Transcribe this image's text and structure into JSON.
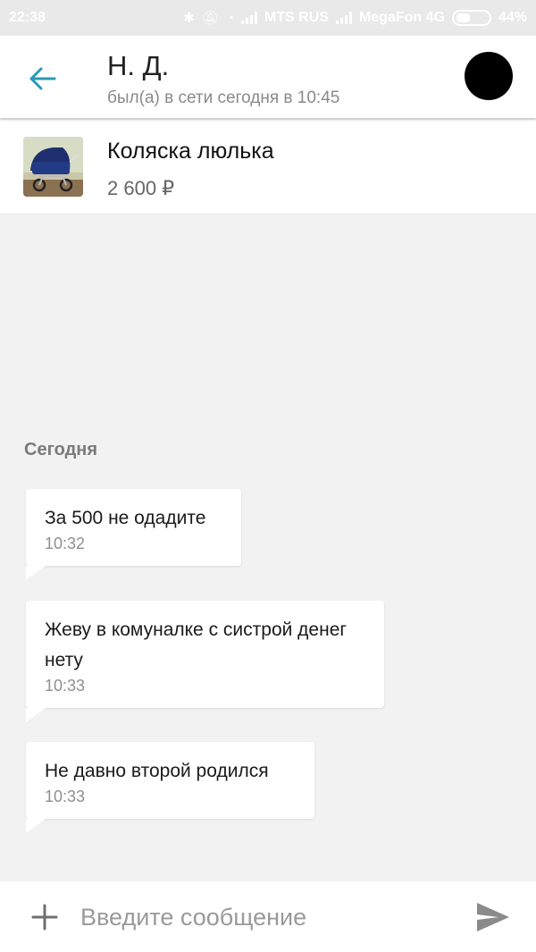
{
  "status_bar": {
    "time": "22:38",
    "carrier1": "MTS RUS",
    "carrier2": "MegaFon 4G",
    "battery": "44%",
    "battery_level": 0.44,
    "icons": [
      "bluetooth-icon",
      "mute-icon",
      "alarm-icon",
      "signal-icon",
      "signal-icon",
      "battery-icon"
    ]
  },
  "header": {
    "back_icon": "arrow-left-icon",
    "title": "Н. Д.",
    "subtitle": "был(а) в сети сегодня в 10:45",
    "accent_color": "#2a9ab7"
  },
  "listing": {
    "name": "Коляска люлька",
    "price": "2 600 ₽"
  },
  "chat": {
    "date_label": "Сегодня",
    "messages": [
      {
        "text": "За 500 не одадите",
        "time": "10:32"
      },
      {
        "text": "Жеву в комуналке с систрой денег нету",
        "time": "10:33"
      },
      {
        "text": "Не давно второй родился",
        "time": "10:33"
      }
    ]
  },
  "input": {
    "placeholder": "Введите сообщение",
    "value": "",
    "plus_icon": "plus-icon",
    "send_icon": "send-icon"
  }
}
